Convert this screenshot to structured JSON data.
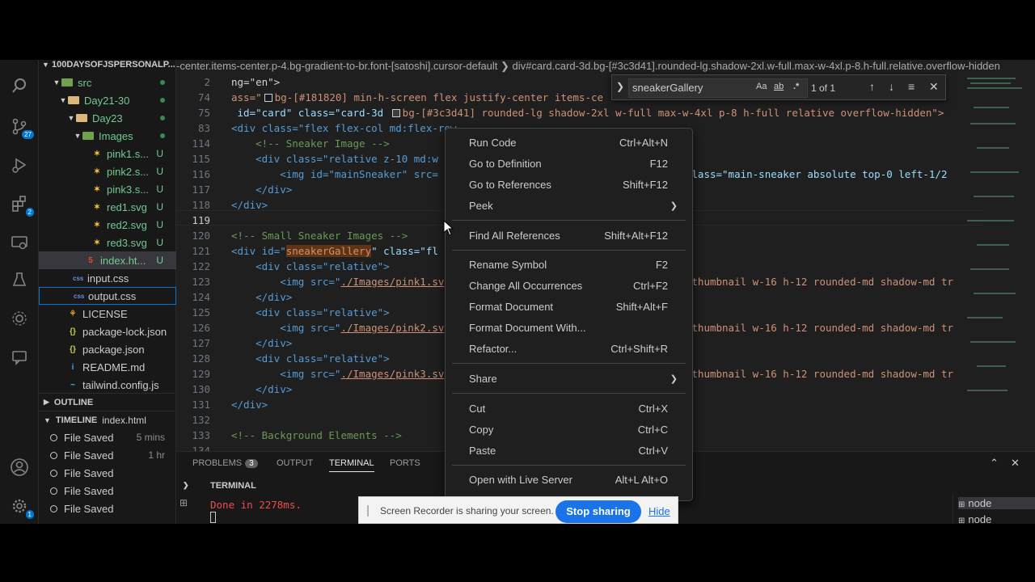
{
  "explorer": {
    "title": "100DAYSOFJSPERSONALP...",
    "tree": [
      {
        "label": "src",
        "kind": "folder-green",
        "dot": true
      },
      {
        "label": "Day21-30",
        "kind": "folder",
        "dot": true
      },
      {
        "label": "Day23",
        "kind": "folder",
        "dot": true
      },
      {
        "label": "Images",
        "kind": "folder-green",
        "dot": true
      },
      {
        "label": "pink1.s...",
        "kind": "svg",
        "status": "U"
      },
      {
        "label": "pink2.s...",
        "kind": "svg",
        "status": "U"
      },
      {
        "label": "pink3.s...",
        "kind": "svg",
        "status": "U"
      },
      {
        "label": "red1.svg",
        "kind": "svg",
        "status": "U"
      },
      {
        "label": "red2.svg",
        "kind": "svg",
        "status": "U"
      },
      {
        "label": "red3.svg",
        "kind": "svg",
        "status": "U"
      },
      {
        "label": "index.ht...",
        "kind": "html",
        "status": "U"
      },
      {
        "label": "input.css",
        "kind": "css"
      },
      {
        "label": "output.css",
        "kind": "css"
      },
      {
        "label": "LICENSE",
        "kind": "license"
      },
      {
        "label": "package-lock.json",
        "kind": "json"
      },
      {
        "label": "package.json",
        "kind": "json"
      },
      {
        "label": "README.md",
        "kind": "md"
      },
      {
        "label": "tailwind.config.js",
        "kind": "js"
      }
    ],
    "outline_label": "OUTLINE",
    "timeline_label": "TIMELINE",
    "timeline_file": "index.html",
    "timeline": [
      {
        "label": "File Saved",
        "time": "5 mins"
      },
      {
        "label": "File Saved",
        "time": "1 hr"
      },
      {
        "label": "File Saved",
        "time": ""
      },
      {
        "label": "File Saved",
        "time": ""
      },
      {
        "label": "File Saved",
        "time": ""
      }
    ]
  },
  "activity": {
    "scm_badge": "27",
    "ext_badge": "2",
    "settings_badge": "1"
  },
  "editor": {
    "breadcrumb": "-center.items-center.p-4.bg-gradient-to-br.font-[satoshi].cursor-default  ❯  div#card.card-3d.bg-[#3c3d41].rounded-lg.shadow-2xl.w-full.max-w-4xl.p-8.h-full.relative.overflow-hidden",
    "lines": {
      "l1_num": "2",
      "l1": "ng=\"en\">",
      "l2_num": "74",
      "l2a": "ass=\"",
      "l2b": "bg-[#181820] min-h-screen flex justify-center items-ce",
      "l3_num": "75",
      "l3a": " id=\"card\" class=\"card-3d ",
      "l3b": "bg-[#3c3d41] rounded-lg shadow-2xl w-full max-w-4xl p-8 h-full relative overflow-hidden\">",
      "l4_num": "83",
      "l4": "<div class=\"flex flex-col md:flex-row ",
      "l5_num": "114",
      "l5": "    <!-- Sneaker Image -->",
      "l6_num": "115",
      "l6a": "    <div class=\"relative z-10 md:w",
      "l7_num": "116",
      "l7a": "        <img id=\"mainSneaker\" src=",
      "l7b": "class=\"main-sneaker absolute top-0 left-1/2",
      "l8_num": "117",
      "l8": "    </div>",
      "l9_num": "118",
      "l9": "</div>",
      "l10_num": "119",
      "l11_num": "120",
      "l11": "<!-- Small Sneaker Images -->",
      "l12_num": "121",
      "l12a": "<div id=\"",
      "l12b": "sneakerGallery",
      "l12c": "\" class=\"fl",
      "l13_num": "122",
      "l13": "    <div class=\"relative\">",
      "l14_num": "123",
      "l14a": "        <img src=\"",
      "l14b": "./Images/pink1.sv",
      "l14c": "thumbnail w-16 h-12 rounded-md shadow-md tr",
      "l15_num": "124",
      "l15": "    </div>",
      "l16_num": "125",
      "l16": "    <div class=\"relative\">",
      "l17_num": "126",
      "l17a": "        <img src=\"",
      "l17b": "./Images/pink2.sv",
      "l17c": "thumbnail w-16 h-12 rounded-md shadow-md tr",
      "l18_num": "127",
      "l18": "    </div>",
      "l19_num": "128",
      "l19": "    <div class=\"relative\">",
      "l20_num": "129",
      "l20a": "        <img src=\"",
      "l20b": "./Images/pink3.sv",
      "l20c": "thumbnail w-16 h-12 rounded-md shadow-md tr",
      "l21_num": "130",
      "l21": "    </div>",
      "l22_num": "131",
      "l22": "</div>",
      "l23_num": "132",
      "l24_num": "133",
      "l24": "<!-- Background Elements -->",
      "l25_num": "134"
    }
  },
  "find": {
    "query": "sneakerGallery",
    "opt_case": "Aa",
    "opt_word": "ab",
    "opt_regex": ".*",
    "count": "1 of 1"
  },
  "panel": {
    "tabs": [
      "PROBLEMS",
      "OUTPUT",
      "TERMINAL",
      "PORTS"
    ],
    "problems_count": "3",
    "terminal_header": "TERMINAL",
    "output": "Done in 2278ms.",
    "terminals": [
      "node",
      "node"
    ]
  },
  "context_menu": {
    "items": [
      {
        "label": "Run Code",
        "key": "Ctrl+Alt+N"
      },
      {
        "label": "Go to Definition",
        "key": "F12"
      },
      {
        "label": "Go to References",
        "key": "Shift+F12"
      },
      {
        "label": "Peek",
        "key": ""
      },
      {
        "label": "Find All References",
        "key": "Shift+Alt+F12"
      },
      {
        "label": "Rename Symbol",
        "key": "F2"
      },
      {
        "label": "Change All Occurrences",
        "key": "Ctrl+F2"
      },
      {
        "label": "Format Document",
        "key": "Shift+Alt+F"
      },
      {
        "label": "Format Document With...",
        "key": ""
      },
      {
        "label": "Refactor...",
        "key": "Ctrl+Shift+R"
      },
      {
        "label": "Share",
        "key": ""
      },
      {
        "label": "Cut",
        "key": "Ctrl+X"
      },
      {
        "label": "Copy",
        "key": "Ctrl+C"
      },
      {
        "label": "Paste",
        "key": "Ctrl+V"
      },
      {
        "label": "Open with Live Server",
        "key": "Alt+L Alt+O"
      }
    ]
  },
  "recorder": {
    "message": "Screen Recorder is sharing your screen.",
    "stop_label": "Stop sharing",
    "hide_label": "Hide"
  },
  "colors": {
    "accent": "#0078d4",
    "untracked": "#73c991",
    "tag": "#569cd6",
    "attr": "#9cdcfe",
    "string": "#ce9178",
    "comment": "#6a9955"
  }
}
